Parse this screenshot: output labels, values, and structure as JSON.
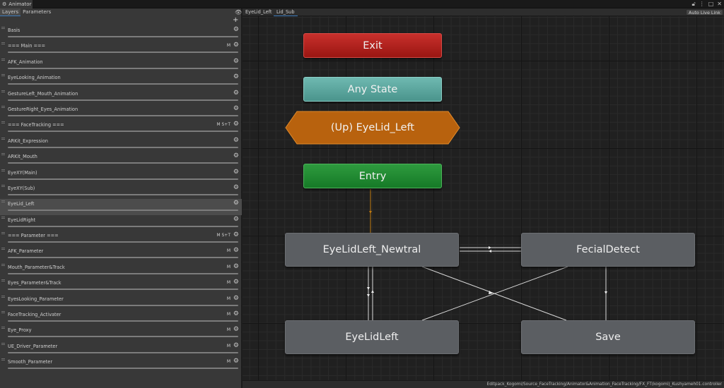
{
  "window": {
    "tab_label": "Animator",
    "tab_icon": "animator-icon",
    "icons": [
      "lock-icon",
      "kebab-icon",
      "maximize-icon",
      "close-icon"
    ]
  },
  "left_panel": {
    "tabs": [
      {
        "label": "Layers",
        "active": true
      },
      {
        "label": "Parameters",
        "active": false
      }
    ],
    "params": [
      {
        "name": "Basis",
        "flags": ""
      },
      {
        "name": "=== Main ===",
        "flags": "M"
      },
      {
        "name": "AFK_Animation",
        "flags": ""
      },
      {
        "name": "EyeLooking_Animation",
        "flags": ""
      },
      {
        "name": "GestureLeft_Mouth_Animation",
        "flags": ""
      },
      {
        "name": "GestureRight_Eyes_Animation",
        "flags": ""
      },
      {
        "name": "=== FaceTracking ===",
        "flags": "M  S+T"
      },
      {
        "name": "ARKit_Expression",
        "flags": ""
      },
      {
        "name": "ARKit_Mouth",
        "flags": ""
      },
      {
        "name": "EyeXY(Main)",
        "flags": ""
      },
      {
        "name": "EyeXY(Sub)",
        "flags": ""
      },
      {
        "name": "EyeLid_Left",
        "flags": "",
        "selected": true
      },
      {
        "name": "EyeLidRight",
        "flags": ""
      },
      {
        "name": "=== Parameter ===",
        "flags": "M  S+T"
      },
      {
        "name": "AFK_Parameter",
        "flags": "M"
      },
      {
        "name": "Mouth_Parameter&Track",
        "flags": "M"
      },
      {
        "name": "Eyes_Parameter&Track",
        "flags": "M"
      },
      {
        "name": "EyesLooking_Parameter",
        "flags": "M"
      },
      {
        "name": "FaceTracking_Activater",
        "flags": "M"
      },
      {
        "name": "Eye_Proxy",
        "flags": "M"
      },
      {
        "name": "UE_Driver_Parameter",
        "flags": "M"
      },
      {
        "name": "Smooth_Parameter",
        "flags": "M"
      }
    ]
  },
  "graph": {
    "breadcrumbs": [
      "EyeLid_Left",
      "Lid_Sub"
    ],
    "live_link": "Auto Live Link",
    "status_path": "Editpack_Kogomi/Source_FaceTracking/Animator&Animation_FaceTracking/FX_FT(kogomi)_Kushyameh01.controller",
    "nodes": {
      "exit": "Exit",
      "any_state": "Any State",
      "up": "(Up) EyeLid_Left",
      "entry": "Entry",
      "s1": "EyeLidLeft_Newtral",
      "s2": "FecialDetect",
      "s3": "EyeLidLeft",
      "s4": "Save"
    },
    "colors": {
      "exit": "#b02520",
      "any_state": "#5ea69e",
      "up": "#c06a10",
      "entry": "#1f8a30",
      "state": "#5b5e62",
      "selection": "#3a79bb"
    }
  }
}
